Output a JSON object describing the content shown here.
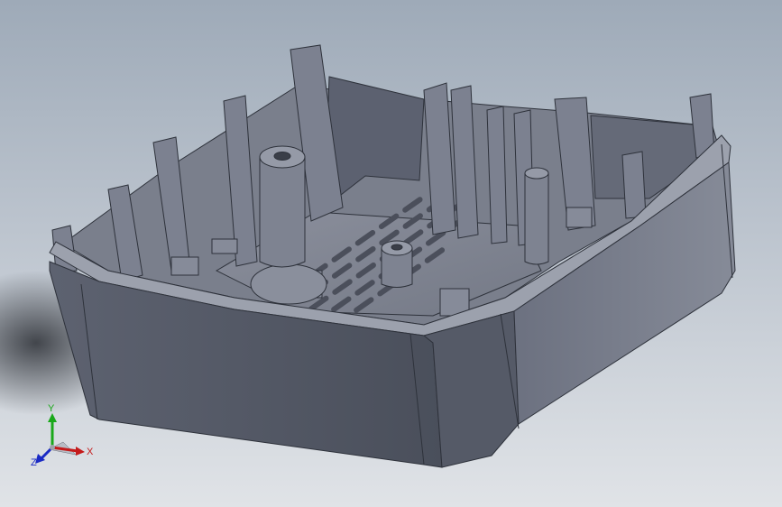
{
  "viewport": {
    "background_top": "#9eaab8",
    "background_bottom": "#e0e3e7",
    "model_color": "#6f7584",
    "edge_color": "#2e323b"
  },
  "triad": {
    "x_label": "X",
    "y_label": "Y",
    "z_label": "Z",
    "x_color": "#c41a1a",
    "y_color": "#1aa81a",
    "z_color": "#1a2ac4"
  }
}
